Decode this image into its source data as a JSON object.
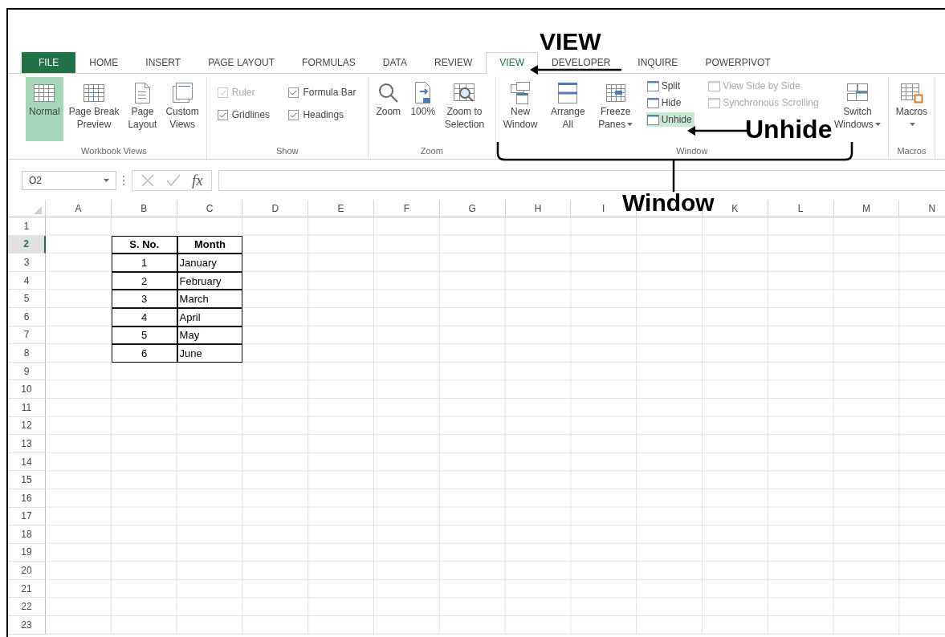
{
  "tabs": [
    {
      "label": "FILE",
      "kind": "file",
      "selected": false
    },
    {
      "label": "HOME",
      "kind": "tab",
      "selected": false
    },
    {
      "label": "INSERT",
      "kind": "tab",
      "selected": false
    },
    {
      "label": "PAGE LAYOUT",
      "kind": "tab",
      "selected": false
    },
    {
      "label": "FORMULAS",
      "kind": "tab",
      "selected": false
    },
    {
      "label": "DATA",
      "kind": "tab",
      "selected": false
    },
    {
      "label": "REVIEW",
      "kind": "tab",
      "selected": false
    },
    {
      "label": "VIEW",
      "kind": "tab",
      "selected": true
    },
    {
      "label": "DEVELOPER",
      "kind": "tab",
      "selected": false
    },
    {
      "label": "INQUIRE",
      "kind": "tab",
      "selected": false
    },
    {
      "label": "POWERPIVOT",
      "kind": "tab",
      "selected": false
    }
  ],
  "ribbon": {
    "groups": [
      {
        "label": "Workbook Views",
        "items": [
          {
            "kind": "large",
            "label": "Normal",
            "selected": true,
            "dropdown": false
          },
          {
            "kind": "large",
            "label": "Page Break\nPreview",
            "selected": false,
            "dropdown": false
          },
          {
            "kind": "large",
            "label": "Page\nLayout",
            "selected": false,
            "dropdown": false
          },
          {
            "kind": "large",
            "label": "Custom\nViews",
            "selected": false,
            "dropdown": false
          }
        ]
      },
      {
        "label": "Show",
        "items": [
          {
            "kind": "check",
            "label": "Ruler",
            "checked": true,
            "disabled": true
          },
          {
            "kind": "check",
            "label": "Formula Bar",
            "checked": true,
            "disabled": false
          },
          {
            "kind": "check",
            "label": "Gridlines",
            "checked": true,
            "disabled": false
          },
          {
            "kind": "check",
            "label": "Headings",
            "checked": true,
            "disabled": false
          }
        ]
      },
      {
        "label": "Zoom",
        "items": [
          {
            "kind": "large",
            "label": "Zoom",
            "selected": false,
            "dropdown": false
          },
          {
            "kind": "large",
            "label": "100%",
            "selected": false,
            "dropdown": false
          },
          {
            "kind": "large",
            "label": "Zoom to\nSelection",
            "selected": false,
            "dropdown": false
          }
        ]
      },
      {
        "label": "Window",
        "items": [
          {
            "kind": "large",
            "label": "New\nWindow",
            "selected": false,
            "dropdown": false
          },
          {
            "kind": "large",
            "label": "Arrange\nAll",
            "selected": false,
            "dropdown": false
          },
          {
            "kind": "large",
            "label": "Freeze\nPanes",
            "selected": false,
            "dropdown": true
          },
          {
            "kind": "stack",
            "items": [
              {
                "label": "Split",
                "selected": false,
                "disabled": false
              },
              {
                "label": "Hide",
                "selected": false,
                "disabled": false
              },
              {
                "label": "Unhide",
                "selected": true,
                "disabled": false
              }
            ]
          },
          {
            "kind": "stack",
            "items": [
              {
                "label": "View Side by Side",
                "selected": false,
                "disabled": true
              },
              {
                "label": "Synchronous Scrolling",
                "selected": false,
                "disabled": true
              }
            ]
          },
          {
            "kind": "large",
            "label": "Switch\nWindows",
            "selected": false,
            "dropdown": true
          }
        ]
      },
      {
        "label": "Macros",
        "items": [
          {
            "kind": "large",
            "label": "Macros",
            "selected": false,
            "dropdown": true
          }
        ]
      }
    ]
  },
  "formula_bar": {
    "name_box": "O2",
    "function_label": "fx"
  },
  "sheet": {
    "columns": [
      "A",
      "B",
      "C",
      "D",
      "E",
      "F",
      "G",
      "H",
      "I",
      null,
      "K",
      "L",
      "M",
      "N"
    ],
    "rows": [
      {
        "header": "1",
        "selected": false
      },
      {
        "header": "2",
        "selected": true
      },
      {
        "header": "3",
        "selected": false
      },
      {
        "header": "4",
        "selected": false
      },
      {
        "header": "5",
        "selected": false
      },
      {
        "header": "6",
        "selected": false
      },
      {
        "header": "7",
        "selected": false
      },
      {
        "header": "8",
        "selected": false
      },
      {
        "header": "9",
        "selected": false
      },
      {
        "header": "10",
        "selected": false
      },
      {
        "header": "11",
        "selected": false
      },
      {
        "header": "12",
        "selected": false
      },
      {
        "header": "13",
        "selected": false
      },
      {
        "header": "14",
        "selected": false
      },
      {
        "header": "15",
        "selected": false
      },
      {
        "header": "16",
        "selected": false
      },
      {
        "header": "17",
        "selected": false
      },
      {
        "header": "18",
        "selected": false
      },
      {
        "header": "19",
        "selected": false
      },
      {
        "header": "20",
        "selected": false
      },
      {
        "header": "21",
        "selected": false
      },
      {
        "header": "22",
        "selected": false
      },
      {
        "header": "23",
        "selected": false
      }
    ],
    "table": {
      "header": [
        "S. No.",
        "Month"
      ],
      "rows": [
        [
          "1",
          "January"
        ],
        [
          "2",
          "February"
        ],
        [
          "3",
          "March"
        ],
        [
          "4",
          "April"
        ],
        [
          "5",
          "May"
        ],
        [
          "6",
          "June"
        ]
      ]
    }
  },
  "annotations": [
    {
      "kind": "arrow",
      "text": "VIEW"
    },
    {
      "kind": "arrow",
      "text": "Unhide"
    },
    {
      "kind": "bracket",
      "text": "Window"
    }
  ]
}
